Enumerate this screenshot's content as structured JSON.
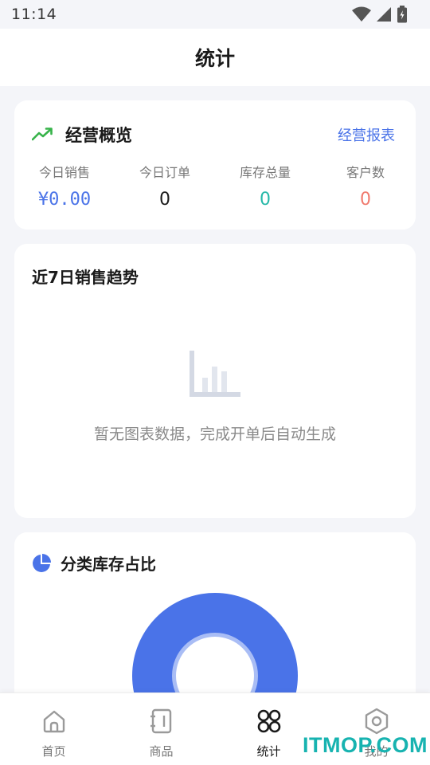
{
  "status_bar": {
    "time": "11:14"
  },
  "header": {
    "title": "统计"
  },
  "overview": {
    "title": "经营概览",
    "link": "经营报表",
    "stats": [
      {
        "label": "今日销售",
        "value": "¥0.00",
        "color": "#4a73e8"
      },
      {
        "label": "今日订单",
        "value": "0",
        "color": "#1a1a1a"
      },
      {
        "label": "库存总量",
        "value": "0",
        "color": "#26b8a8"
      },
      {
        "label": "客户数",
        "value": "0",
        "color": "#f07a6e"
      }
    ]
  },
  "trend": {
    "title": "近7日销售趋势",
    "empty_text": "暂无图表数据，完成开单后自动生成"
  },
  "category": {
    "title": "分类库存占比"
  },
  "tabbar": {
    "tabs": [
      {
        "label": "首页",
        "icon": "home-icon",
        "active": false
      },
      {
        "label": "商品",
        "icon": "book-icon",
        "active": false
      },
      {
        "label": "统计",
        "icon": "four-leaf-icon",
        "active": true
      },
      {
        "label": "我的",
        "icon": "hexagon-settings-icon",
        "active": false
      }
    ]
  },
  "watermark": "ITMOP.COM",
  "colors": {
    "accent": "#4a73e8",
    "trend_icon": "#37b34a",
    "teal": "#26b8a8",
    "coral": "#f07a6e",
    "background": "#f4f5f9"
  }
}
